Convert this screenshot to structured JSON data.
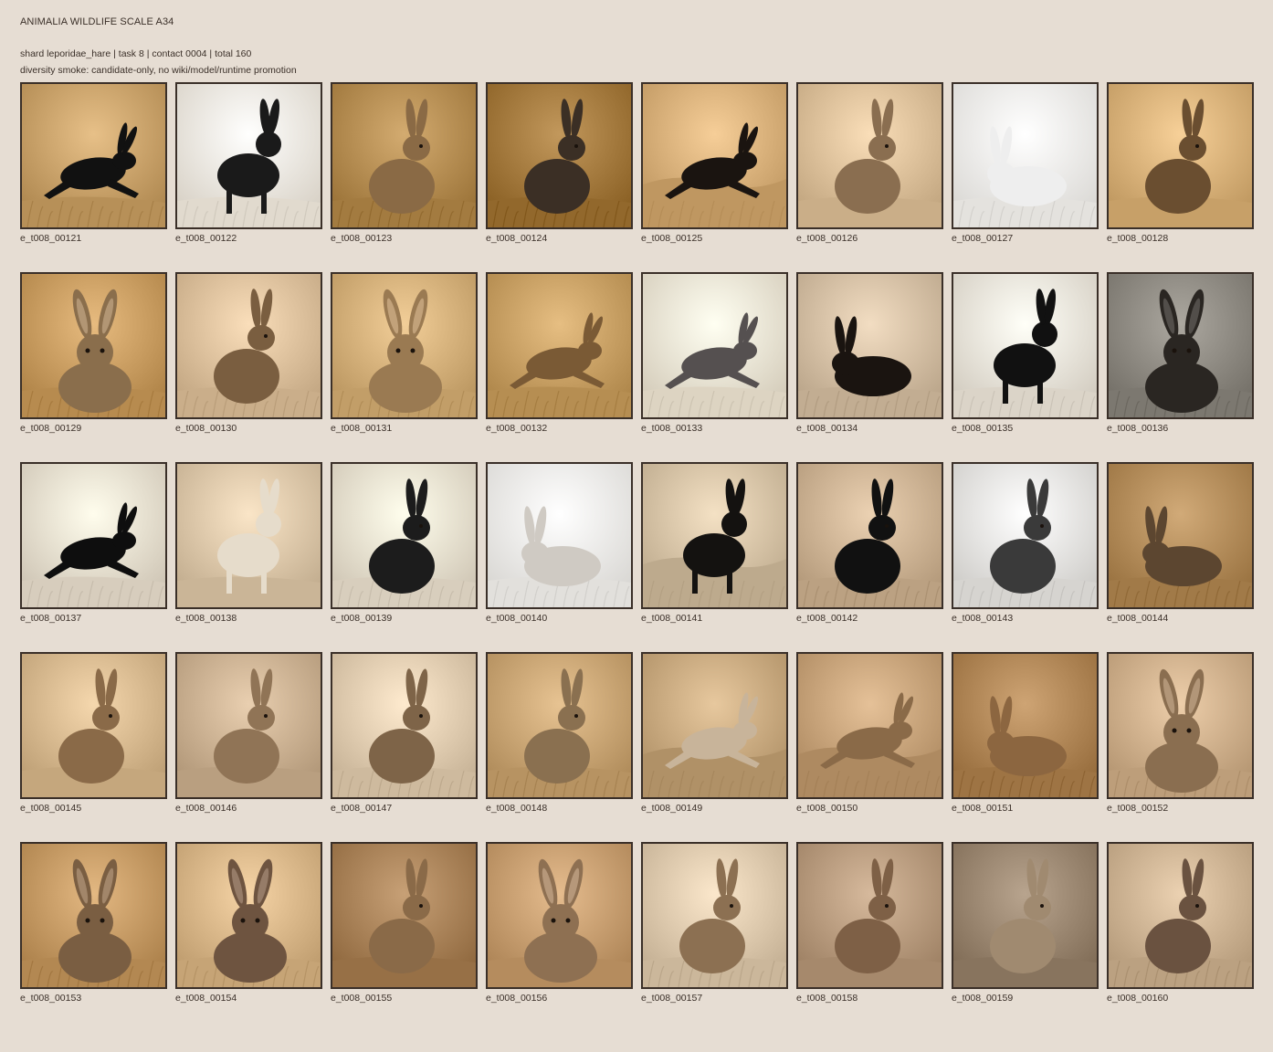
{
  "header": {
    "title": "ANIMALIA WILDLIFE SCALE A34",
    "meta_line1": "shard leporidae_hare | task 8 | contact 0004 | total 160",
    "meta_line2": "diversity smoke: candidate-only, no wiki/model/runtime promotion"
  },
  "items": [
    {
      "id": "e_t008_00121",
      "style": "silhouette",
      "bg": "#c9a26a",
      "hare": "#111111",
      "pose": "run",
      "grass": true
    },
    {
      "id": "e_t008_00122",
      "style": "sketch",
      "bg": "#f3ece0",
      "hare": "#1a1a1a",
      "pose": "stand",
      "grass": true
    },
    {
      "id": "e_t008_00123",
      "style": "photo",
      "bg": "#b58d52",
      "hare": "#8a6a45",
      "pose": "sit",
      "grass": true
    },
    {
      "id": "e_t008_00124",
      "style": "photo",
      "bg": "#a47a3e",
      "hare": "#3b2f25",
      "pose": "sit",
      "grass": true
    },
    {
      "id": "e_t008_00125",
      "style": "landscape",
      "bg": "#d8b07a",
      "hare": "#1a1410",
      "pose": "run",
      "grass": true
    },
    {
      "id": "e_t008_00126",
      "style": "photo",
      "bg": "#dcc09a",
      "hare": "#8a6e50",
      "pose": "sit",
      "grass": false
    },
    {
      "id": "e_t008_00127",
      "style": "sketch",
      "bg": "#f6f4f0",
      "hare": "#eeeeee",
      "pose": "crouch",
      "grass": true
    },
    {
      "id": "e_t008_00128",
      "style": "photo",
      "bg": "#d9b27a",
      "hare": "#6a4e30",
      "pose": "sit",
      "grass": false
    },
    {
      "id": "e_t008_00129",
      "style": "photo",
      "bg": "#c99d61",
      "hare": "#8a6e4c",
      "pose": "front",
      "grass": true
    },
    {
      "id": "e_t008_00130",
      "style": "photo",
      "bg": "#dcc09c",
      "hare": "#7a5e40",
      "pose": "sit",
      "grass": true
    },
    {
      "id": "e_t008_00131",
      "style": "photo",
      "bg": "#d4b07a",
      "hare": "#9a7a52",
      "pose": "front",
      "grass": true
    },
    {
      "id": "e_t008_00132",
      "style": "photo",
      "bg": "#c8a064",
      "hare": "#7a5a35",
      "pose": "run",
      "grass": true
    },
    {
      "id": "e_t008_00133",
      "style": "sketch",
      "bg": "#efe6d4",
      "hare": "#555050",
      "pose": "run",
      "grass": true
    },
    {
      "id": "e_t008_00134",
      "style": "silhouette",
      "bg": "#d4bfa4",
      "hare": "#1a1410",
      "pose": "crouch",
      "grass": true
    },
    {
      "id": "e_t008_00135",
      "style": "silhouette",
      "bg": "#ede6da",
      "hare": "#111111",
      "pose": "stand",
      "grass": true
    },
    {
      "id": "e_t008_00136",
      "style": "silhouette",
      "bg": "#8e8a82",
      "hare": "#2a2622",
      "pose": "front",
      "grass": true
    },
    {
      "id": "e_t008_00137",
      "style": "silhouette",
      "bg": "#e9dfcf",
      "hare": "#0e0e0e",
      "pose": "run",
      "grass": true
    },
    {
      "id": "e_t008_00138",
      "style": "sketch",
      "bg": "#dcc7a9",
      "hare": "#e6dccb",
      "pose": "stand",
      "grass": false
    },
    {
      "id": "e_t008_00139",
      "style": "sketch",
      "bg": "#eae0cf",
      "hare": "#1c1c1c",
      "pose": "sit",
      "grass": true
    },
    {
      "id": "e_t008_00140",
      "style": "sketch",
      "bg": "#f4f2ee",
      "hare": "#cfcac3",
      "pose": "crouch",
      "grass": true
    },
    {
      "id": "e_t008_00141",
      "style": "landscape",
      "bg": "#d6c3a6",
      "hare": "#141210",
      "pose": "stand",
      "grass": true
    },
    {
      "id": "e_t008_00142",
      "style": "silhouette",
      "bg": "#cdb394",
      "hare": "#111111",
      "pose": "sit",
      "grass": true
    },
    {
      "id": "e_t008_00143",
      "style": "sketch",
      "bg": "#e8e6e2",
      "hare": "#3a3a3a",
      "pose": "sit",
      "grass": true
    },
    {
      "id": "e_t008_00144",
      "style": "photo",
      "bg": "#b38c5a",
      "hare": "#5c4630",
      "pose": "crouch",
      "grass": true
    },
    {
      "id": "e_t008_00145",
      "style": "photo",
      "bg": "#d7b98f",
      "hare": "#8a6a48",
      "pose": "sit",
      "grass": false
    },
    {
      "id": "e_t008_00146",
      "style": "photo",
      "bg": "#cbb192",
      "hare": "#907456",
      "pose": "sit",
      "grass": false
    },
    {
      "id": "e_t008_00147",
      "style": "photo",
      "bg": "#e0ccb0",
      "hare": "#7e6448",
      "pose": "sit",
      "grass": true
    },
    {
      "id": "e_t008_00148",
      "style": "photo",
      "bg": "#c9a574",
      "hare": "#8a7050",
      "pose": "sit",
      "grass": true
    },
    {
      "id": "e_t008_00149",
      "style": "landscape",
      "bg": "#c9aa80",
      "hare": "#c8b49a",
      "pose": "run",
      "grass": true
    },
    {
      "id": "e_t008_00150",
      "style": "landscape",
      "bg": "#c7a37a",
      "hare": "#8a6a48",
      "pose": "run",
      "grass": true
    },
    {
      "id": "e_t008_00151",
      "style": "photo",
      "bg": "#b08656",
      "hare": "#8c6640",
      "pose": "crouch",
      "grass": true
    },
    {
      "id": "e_t008_00152",
      "style": "photo",
      "bg": "#cfb08c",
      "hare": "#8a6e50",
      "pose": "front",
      "grass": true
    },
    {
      "id": "e_t008_00153",
      "style": "photo",
      "bg": "#c59a64",
      "hare": "#7a5e42",
      "pose": "front",
      "grass": true
    },
    {
      "id": "e_t008_00154",
      "style": "photo",
      "bg": "#d8b688",
      "hare": "#6e5440",
      "pose": "front",
      "grass": true
    },
    {
      "id": "e_t008_00155",
      "style": "photo",
      "bg": "#a98258",
      "hare": "#8a6a48",
      "pose": "sit",
      "grass": false
    },
    {
      "id": "e_t008_00156",
      "style": "photo",
      "bg": "#c79e70",
      "hare": "#8e7052",
      "pose": "front",
      "grass": false
    },
    {
      "id": "e_t008_00157",
      "style": "photo",
      "bg": "#ddc9ad",
      "hare": "#8c7052",
      "pose": "sit",
      "grass": true
    },
    {
      "id": "e_t008_00158",
      "style": "photo",
      "bg": "#b89b7e",
      "hare": "#7e6046",
      "pose": "sit",
      "grass": false
    },
    {
      "id": "e_t008_00159",
      "style": "photo",
      "bg": "#9a8670",
      "hare": "#a08a70",
      "pose": "sit",
      "grass": false
    },
    {
      "id": "e_t008_00160",
      "style": "photo",
      "bg": "#cdb393",
      "hare": "#6a5240",
      "pose": "sit",
      "grass": true
    }
  ]
}
